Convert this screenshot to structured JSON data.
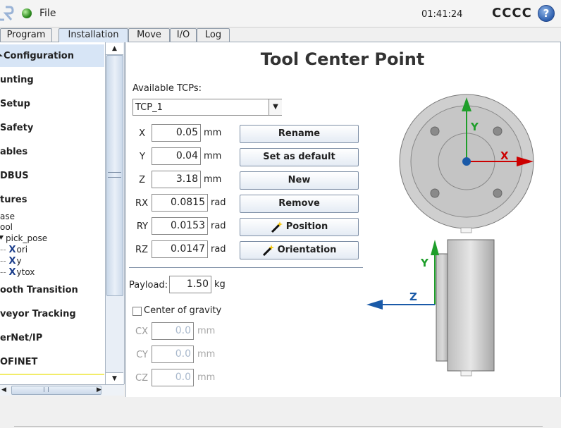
{
  "topbar": {
    "file_menu": "File",
    "clock": "01:41:24",
    "robot_name": "CCCC",
    "help": "?"
  },
  "tabs": [
    {
      "label": "Program",
      "active": false
    },
    {
      "label": "Installation",
      "active": true
    },
    {
      "label": "Move",
      "active": false
    },
    {
      "label": "I/O",
      "active": false
    },
    {
      "label": "Log",
      "active": false
    }
  ],
  "sidebar": {
    "items": [
      "Configuration",
      "unting",
      "Setup",
      "Safety",
      "ables",
      "DBUS",
      "tures",
      "ooth Transition",
      "veyor Tracking",
      "erNet/IP",
      "OFINET"
    ],
    "features": {
      "base": "ase",
      "tool": "ool",
      "pick_pose": "pick_pose",
      "children": [
        "ori",
        "y",
        "ytox"
      ]
    }
  },
  "main": {
    "title": "Tool Center Point",
    "available_label": "Available TCPs:",
    "selected_tcp": "TCP_1",
    "coords": [
      {
        "axis": "X",
        "value": "0.05",
        "unit": "mm"
      },
      {
        "axis": "Y",
        "value": "0.04",
        "unit": "mm"
      },
      {
        "axis": "Z",
        "value": "3.18",
        "unit": "mm"
      },
      {
        "axis": "RX",
        "value": "0.0815",
        "unit": "rad"
      },
      {
        "axis": "RY",
        "value": "0.0153",
        "unit": "rad"
      },
      {
        "axis": "RZ",
        "value": "0.0147",
        "unit": "rad"
      }
    ],
    "buttons": {
      "rename": "Rename",
      "set_default": "Set as default",
      "new": "New",
      "remove": "Remove",
      "position": "Position",
      "orientation": "Orientation"
    },
    "payload": {
      "label": "Payload:",
      "value": "1.50",
      "unit": "kg"
    },
    "cog": {
      "label": "Center of gravity",
      "checked": false,
      "fields": [
        {
          "axis": "CX",
          "value": "0.0",
          "unit": "mm"
        },
        {
          "axis": "CY",
          "value": "0.0",
          "unit": "mm"
        },
        {
          "axis": "CZ",
          "value": "0.0",
          "unit": "mm"
        }
      ]
    },
    "diagram": {
      "top_x_label": "X",
      "top_y_label": "Y",
      "side_y_label": "Y",
      "side_z_label": "Z"
    }
  },
  "colors": {
    "x_axis": "#cc0000",
    "y_axis": "#1e9e2a",
    "z_axis": "#1a5aa8",
    "active_tab": "#dbe7f6"
  }
}
